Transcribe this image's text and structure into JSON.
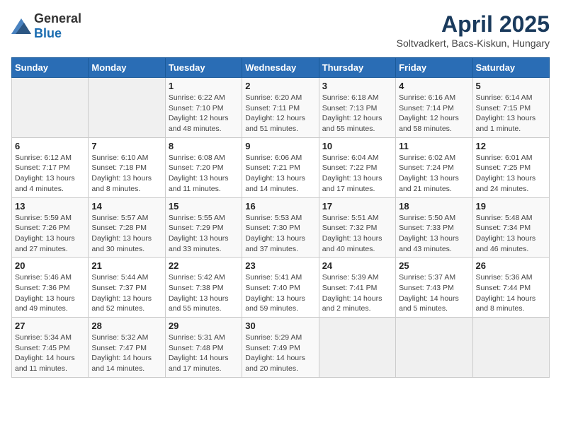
{
  "logo": {
    "general": "General",
    "blue": "Blue"
  },
  "title": "April 2025",
  "subtitle": "Soltvadkert, Bacs-Kiskun, Hungary",
  "headers": [
    "Sunday",
    "Monday",
    "Tuesday",
    "Wednesday",
    "Thursday",
    "Friday",
    "Saturday"
  ],
  "weeks": [
    [
      {
        "day": "",
        "info": ""
      },
      {
        "day": "",
        "info": ""
      },
      {
        "day": "1",
        "info": "Sunrise: 6:22 AM\nSunset: 7:10 PM\nDaylight: 12 hours\nand 48 minutes."
      },
      {
        "day": "2",
        "info": "Sunrise: 6:20 AM\nSunset: 7:11 PM\nDaylight: 12 hours\nand 51 minutes."
      },
      {
        "day": "3",
        "info": "Sunrise: 6:18 AM\nSunset: 7:13 PM\nDaylight: 12 hours\nand 55 minutes."
      },
      {
        "day": "4",
        "info": "Sunrise: 6:16 AM\nSunset: 7:14 PM\nDaylight: 12 hours\nand 58 minutes."
      },
      {
        "day": "5",
        "info": "Sunrise: 6:14 AM\nSunset: 7:15 PM\nDaylight: 13 hours\nand 1 minute."
      }
    ],
    [
      {
        "day": "6",
        "info": "Sunrise: 6:12 AM\nSunset: 7:17 PM\nDaylight: 13 hours\nand 4 minutes."
      },
      {
        "day": "7",
        "info": "Sunrise: 6:10 AM\nSunset: 7:18 PM\nDaylight: 13 hours\nand 8 minutes."
      },
      {
        "day": "8",
        "info": "Sunrise: 6:08 AM\nSunset: 7:20 PM\nDaylight: 13 hours\nand 11 minutes."
      },
      {
        "day": "9",
        "info": "Sunrise: 6:06 AM\nSunset: 7:21 PM\nDaylight: 13 hours\nand 14 minutes."
      },
      {
        "day": "10",
        "info": "Sunrise: 6:04 AM\nSunset: 7:22 PM\nDaylight: 13 hours\nand 17 minutes."
      },
      {
        "day": "11",
        "info": "Sunrise: 6:02 AM\nSunset: 7:24 PM\nDaylight: 13 hours\nand 21 minutes."
      },
      {
        "day": "12",
        "info": "Sunrise: 6:01 AM\nSunset: 7:25 PM\nDaylight: 13 hours\nand 24 minutes."
      }
    ],
    [
      {
        "day": "13",
        "info": "Sunrise: 5:59 AM\nSunset: 7:26 PM\nDaylight: 13 hours\nand 27 minutes."
      },
      {
        "day": "14",
        "info": "Sunrise: 5:57 AM\nSunset: 7:28 PM\nDaylight: 13 hours\nand 30 minutes."
      },
      {
        "day": "15",
        "info": "Sunrise: 5:55 AM\nSunset: 7:29 PM\nDaylight: 13 hours\nand 33 minutes."
      },
      {
        "day": "16",
        "info": "Sunrise: 5:53 AM\nSunset: 7:30 PM\nDaylight: 13 hours\nand 37 minutes."
      },
      {
        "day": "17",
        "info": "Sunrise: 5:51 AM\nSunset: 7:32 PM\nDaylight: 13 hours\nand 40 minutes."
      },
      {
        "day": "18",
        "info": "Sunrise: 5:50 AM\nSunset: 7:33 PM\nDaylight: 13 hours\nand 43 minutes."
      },
      {
        "day": "19",
        "info": "Sunrise: 5:48 AM\nSunset: 7:34 PM\nDaylight: 13 hours\nand 46 minutes."
      }
    ],
    [
      {
        "day": "20",
        "info": "Sunrise: 5:46 AM\nSunset: 7:36 PM\nDaylight: 13 hours\nand 49 minutes."
      },
      {
        "day": "21",
        "info": "Sunrise: 5:44 AM\nSunset: 7:37 PM\nDaylight: 13 hours\nand 52 minutes."
      },
      {
        "day": "22",
        "info": "Sunrise: 5:42 AM\nSunset: 7:38 PM\nDaylight: 13 hours\nand 55 minutes."
      },
      {
        "day": "23",
        "info": "Sunrise: 5:41 AM\nSunset: 7:40 PM\nDaylight: 13 hours\nand 59 minutes."
      },
      {
        "day": "24",
        "info": "Sunrise: 5:39 AM\nSunset: 7:41 PM\nDaylight: 14 hours\nand 2 minutes."
      },
      {
        "day": "25",
        "info": "Sunrise: 5:37 AM\nSunset: 7:43 PM\nDaylight: 14 hours\nand 5 minutes."
      },
      {
        "day": "26",
        "info": "Sunrise: 5:36 AM\nSunset: 7:44 PM\nDaylight: 14 hours\nand 8 minutes."
      }
    ],
    [
      {
        "day": "27",
        "info": "Sunrise: 5:34 AM\nSunset: 7:45 PM\nDaylight: 14 hours\nand 11 minutes."
      },
      {
        "day": "28",
        "info": "Sunrise: 5:32 AM\nSunset: 7:47 PM\nDaylight: 14 hours\nand 14 minutes."
      },
      {
        "day": "29",
        "info": "Sunrise: 5:31 AM\nSunset: 7:48 PM\nDaylight: 14 hours\nand 17 minutes."
      },
      {
        "day": "30",
        "info": "Sunrise: 5:29 AM\nSunset: 7:49 PM\nDaylight: 14 hours\nand 20 minutes."
      },
      {
        "day": "",
        "info": ""
      },
      {
        "day": "",
        "info": ""
      },
      {
        "day": "",
        "info": ""
      }
    ]
  ]
}
